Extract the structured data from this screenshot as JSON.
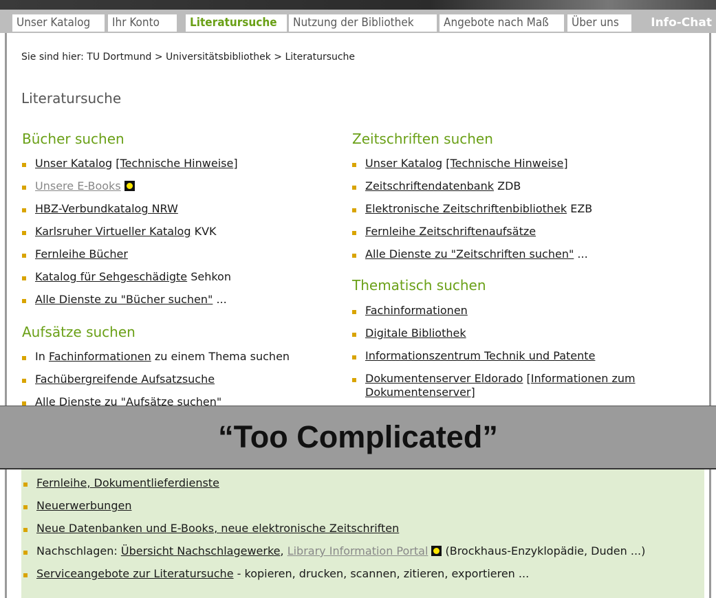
{
  "nav": {
    "tabs": [
      {
        "label": "Unser Katalog"
      },
      {
        "label": "Ihr Konto"
      },
      {
        "label": "Literatursuche"
      },
      {
        "label": "Nutzung der Bibliothek"
      },
      {
        "label": "Angebote nach Maß"
      },
      {
        "label": "Über uns"
      }
    ],
    "chat_label": "Info-Chat"
  },
  "breadcrumb": "Sie sind hier: TU Dortmund > Universitätsbibliothek > Literatursuche",
  "page_title": "Literatursuche",
  "books": {
    "heading": "Bücher suchen",
    "items": [
      {
        "link": "Unser Katalog",
        "sep": " [",
        "link2": "Technische Hinweise",
        "end": "]"
      },
      {
        "link": "Unsere E-Books"
      },
      {
        "link": "HBZ-Verbundkatalog NRW"
      },
      {
        "link": "Karlsruher Virtueller Katalog",
        "suffix": " KVK"
      },
      {
        "link": "Fernleihe Bücher"
      },
      {
        "link": "Katalog für Sehgeschädigte",
        "suffix": " Sehkon"
      },
      {
        "link": "Alle Dienste zu \"Bücher suchen\"",
        "suffix": " ..."
      }
    ]
  },
  "articles": {
    "heading": "Aufsätze suchen",
    "items": [
      {
        "prefix": "In ",
        "link": "Fachinformationen",
        "suffix": " zu einem Thema suchen"
      },
      {
        "link": "Fachübergreifende Aufsatzsuche"
      },
      {
        "link": "Alle Dienste zu \"Aufsätze suchen\""
      }
    ]
  },
  "journals": {
    "heading": "Zeitschriften suchen",
    "items": [
      {
        "link": "Unser Katalog",
        "sep": " [",
        "link2": "Technische Hinweise",
        "end": "]"
      },
      {
        "link": "Zeitschriftendatenbank",
        "suffix": " ZDB"
      },
      {
        "link": "Elektronische Zeitschriftenbibliothek",
        "suffix": " EZB"
      },
      {
        "link": "Fernleihe Zeitschriftenaufsätze"
      },
      {
        "link": "Alle Dienste zu \"Zeitschriften suchen\"",
        "suffix": " ..."
      }
    ]
  },
  "thematic": {
    "heading": "Thematisch suchen",
    "items": [
      {
        "link": "Fachinformationen"
      },
      {
        "link": "Digitale Bibliothek"
      },
      {
        "link": "Informationszentrum Technik und Patente"
      },
      {
        "link": "Dokumentenserver Eldorado",
        "sep": " [",
        "link2a": "Informationen zum",
        "link2b": "Dokumentenserver",
        "end": "]"
      }
    ]
  },
  "services": {
    "items": [
      {
        "link": "Fernleihe, Dokumentlieferdienste"
      },
      {
        "link": "Neuerwerbungen"
      },
      {
        "link": "Neue Datenbanken und E-Books, neue elektronische Zeitschriften"
      },
      {
        "prefix": "Nachschlagen: ",
        "link": "Übersicht Nachschlagewerke",
        "sep": ", ",
        "link2": "Library Information Portal",
        "suffix": " (Brockhaus-Enzyklopädie, Duden ...)"
      },
      {
        "link": "Serviceangebote zur Literatursuche",
        "suffix": " - kopieren, drucken, scannen, zitieren, exportieren ..."
      }
    ]
  },
  "overlay_caption": "“Too Complicated”",
  "colors": {
    "accent_green": "#6aa017",
    "bullet": "#d9a400",
    "service_bg": "#e0edd2",
    "overlay_bg": "#9b9b9b"
  }
}
